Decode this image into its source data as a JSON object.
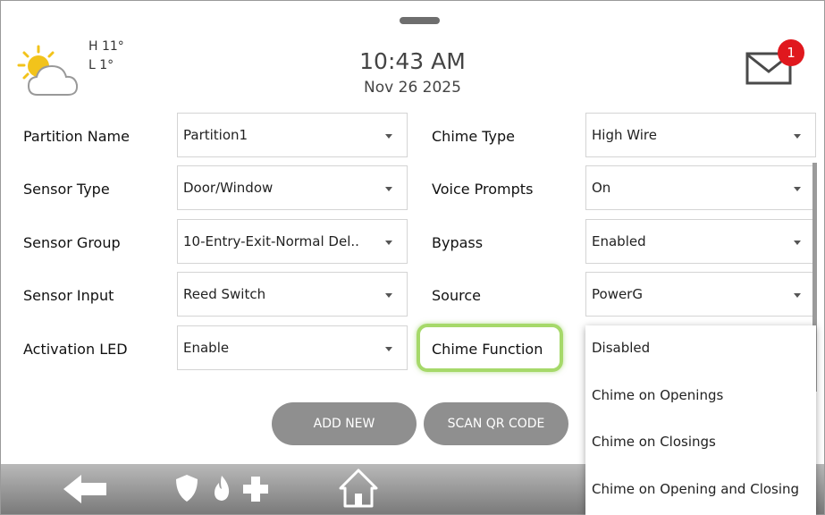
{
  "weather": {
    "icon": "partly-cloudy-icon",
    "high": "H 11°",
    "low": "L 1°"
  },
  "clock": {
    "time": "10:43 AM",
    "date": "Nov 26 2025"
  },
  "messages": {
    "icon": "envelope-icon",
    "count": "1"
  },
  "form": {
    "left": [
      {
        "label": "Partition Name",
        "value": "Partition1"
      },
      {
        "label": "Sensor Type",
        "value": "Door/Window"
      },
      {
        "label": "Sensor Group",
        "value": "10-Entry-Exit-Normal Del.."
      },
      {
        "label": "Sensor Input",
        "value": "Reed Switch"
      },
      {
        "label": "Activation LED",
        "value": "Enable"
      }
    ],
    "right": [
      {
        "label": "Chime Type",
        "value": "High Wire"
      },
      {
        "label": "Voice Prompts",
        "value": "On"
      },
      {
        "label": "Bypass",
        "value": "Enabled"
      },
      {
        "label": "Source",
        "value": "PowerG"
      },
      {
        "label": "Chime Function"
      }
    ]
  },
  "dropdown": {
    "options": [
      "Disabled",
      "Chime on Openings",
      "Chime on Closings",
      "Chime on Opening and Closing"
    ]
  },
  "buttons": {
    "add_new": "ADD NEW",
    "scan_qr": "SCAN QR CODE"
  },
  "navbar": {
    "icons": [
      "back-arrow-icon",
      "shield-icon",
      "fire-icon",
      "medical-cross-icon",
      "home-icon"
    ]
  },
  "colors": {
    "highlight": "#a6d96a",
    "badge": "#e0181e",
    "button": "#8f8f8f",
    "weather_sun": "#f2c31b"
  }
}
